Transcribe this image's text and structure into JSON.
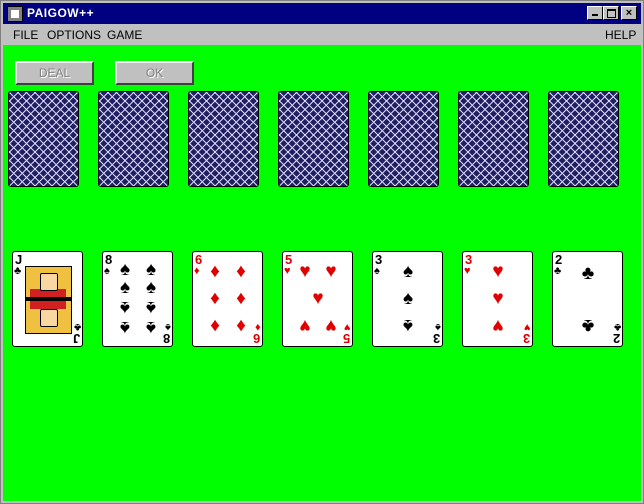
{
  "window": {
    "title": "PAIGOW++"
  },
  "titlebar": {
    "close_glyph": "×"
  },
  "menu": {
    "items": [
      {
        "label": "FILE"
      },
      {
        "label": "OPTIONS"
      },
      {
        "label": "GAME"
      },
      {
        "label": "HELP"
      }
    ]
  },
  "buttons": {
    "deal": "DEAL",
    "ok": "OK"
  },
  "colors": {
    "table": "#00ff00",
    "titlebar": "#000080",
    "card_back": "#202060",
    "red_suit": "#e00000"
  },
  "dealer_hand": {
    "face_down_count": 7
  },
  "player_hand": [
    {
      "rank": "J",
      "suit": "♣",
      "color": "black"
    },
    {
      "rank": "8",
      "suit": "♠",
      "color": "black"
    },
    {
      "rank": "6",
      "suit": "♦",
      "color": "red"
    },
    {
      "rank": "5",
      "suit": "♥",
      "color": "red"
    },
    {
      "rank": "3",
      "suit": "♠",
      "color": "black"
    },
    {
      "rank": "3",
      "suit": "♥",
      "color": "red"
    },
    {
      "rank": "2",
      "suit": "♣",
      "color": "black"
    }
  ]
}
